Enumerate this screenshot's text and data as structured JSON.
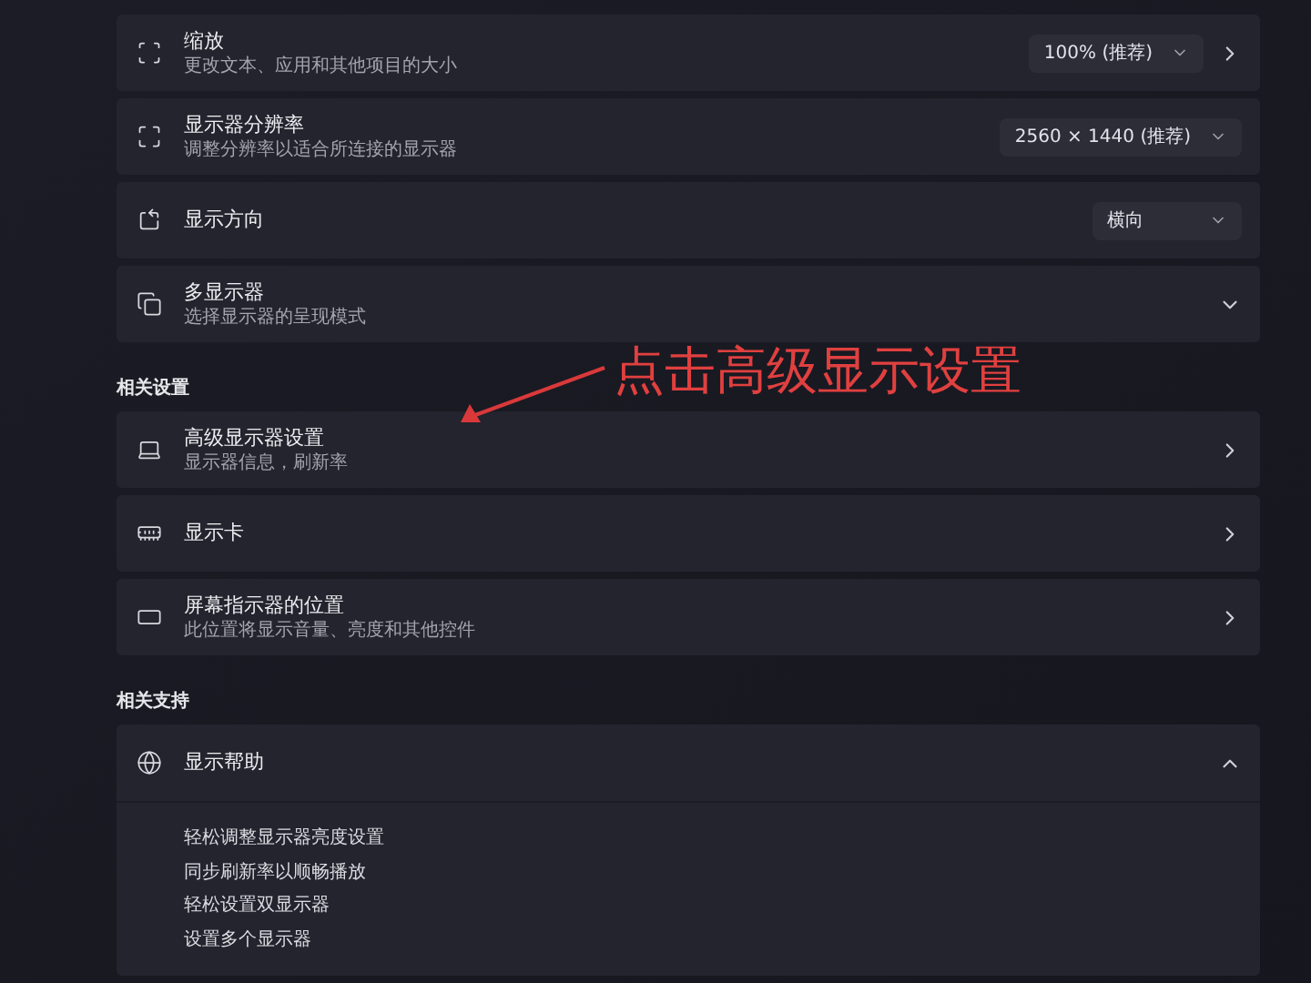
{
  "sections": [
    {
      "items": [
        {
          "kind": "dropdown",
          "title": "缩放",
          "subtitle": "更改文本、应用和其他项目的大小",
          "value": "100% (推荐)",
          "has_arrow": true
        },
        {
          "kind": "dropdown",
          "title": "显示器分辨率",
          "subtitle": "调整分辨率以适合所连接的显示器",
          "value": "2560 × 1440 (推荐)",
          "has_arrow": false
        },
        {
          "kind": "dropdown",
          "title": "显示方向",
          "value": "横向",
          "has_arrow": false
        },
        {
          "kind": "expander",
          "title": "多显示器",
          "subtitle": "选择显示器的呈现模式",
          "expanded": false
        }
      ]
    },
    {
      "heading": "相关设置",
      "items": [
        {
          "kind": "link",
          "title": "高级显示器设置",
          "subtitle": "显示器信息，刷新率"
        },
        {
          "kind": "link",
          "title": "显示卡"
        },
        {
          "kind": "link",
          "title": "屏幕指示器的位置",
          "subtitle": "此位置将显示音量、亮度和其他控件"
        }
      ]
    },
    {
      "heading": "相关支持",
      "items": [
        {
          "kind": "expander",
          "title": "显示帮助",
          "expanded": true,
          "links": [
            "轻松调整显示器亮度设置",
            "同步刷新率以顺畅播放",
            "轻松设置双显示器",
            "设置多个显示器"
          ]
        }
      ]
    }
  ],
  "annotation": {
    "text": "点击高级显示设置"
  }
}
